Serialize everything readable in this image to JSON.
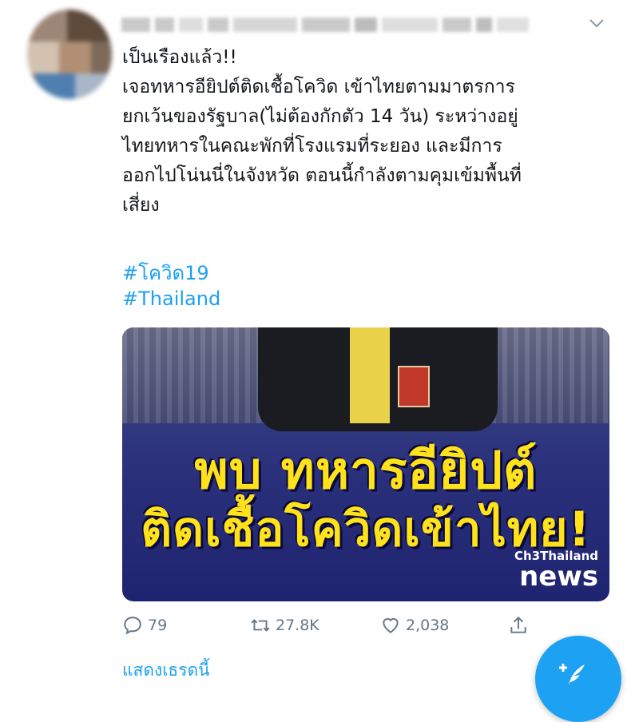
{
  "tweet": {
    "text": "เป็นเรืองแล้ว!!\nเจอทหารอียิปต์ติดเชื้อโควิด เข้าไทยตามมาตรการ\nยกเว้นของรัฐบาล(ไม่ต้องกักตัว 14 วัน) ระหว่างอยู่\nไทยทหารในคณะพักที่โรงแรมที่ระยอง และมีการ\nออกไปโน่นนี่ในจังหวัด ตอนนี้กำลังตามคุมเข้มพื้นที่\nเสี่ยง",
    "hashtags": [
      "#โควิด19",
      "#Thailand"
    ]
  },
  "media": {
    "headline_line1": "พบ ทหารอียิปต์",
    "headline_line2": "ติดเชื้อโควิดเข้าไทย!",
    "channel": "Ch3Thailand",
    "brand": "news"
  },
  "actions": {
    "replies": "79",
    "retweets": "27.8K",
    "likes": "2,038"
  },
  "show_thread_label": "แสดงเธรดนี้",
  "icons": {
    "reply": "reply-icon",
    "retweet": "retweet-icon",
    "like": "heart-icon",
    "share": "share-icon",
    "more": "chevron-down-icon",
    "compose": "compose-tweet-icon"
  },
  "colors": {
    "accent": "#1da1f2",
    "text": "#14171a",
    "muted": "#657786"
  }
}
